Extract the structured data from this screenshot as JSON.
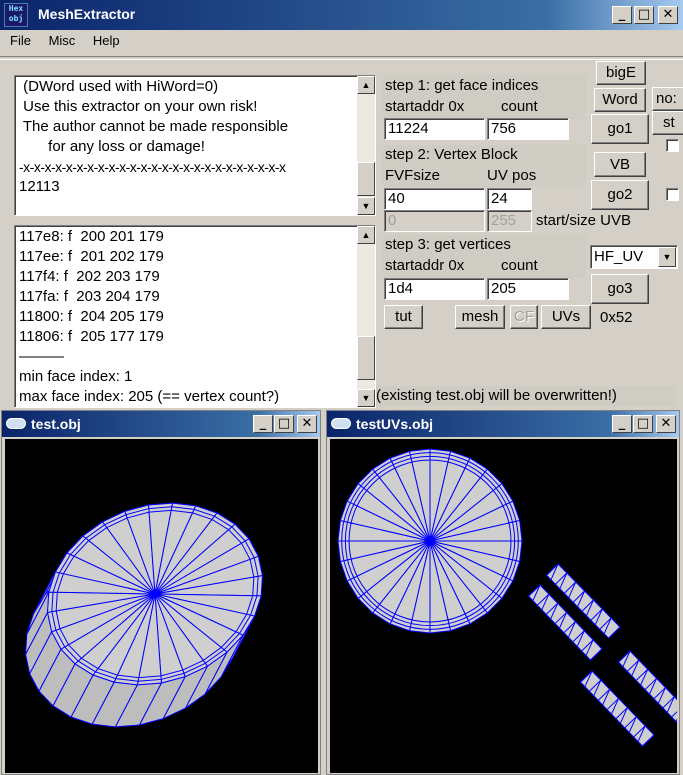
{
  "main_window": {
    "title": "MeshExtractor",
    "icon_text_top": "Hex",
    "icon_text_bottom": "obj",
    "minimize": "_",
    "maximize": "□",
    "close": "✕"
  },
  "menu": [
    "File",
    "Misc",
    "Help"
  ],
  "info_text": {
    "lines": [
      " (DWord used with HiWord=0)",
      "",
      " Use this extractor on your own risk!",
      " The author cannot be made responsible",
      "       for any loss or damage!",
      "-x-x-x-x-x-x-x-x-x-x-x-x-x-x-x-x-x-x-x-x-x-x-x-x-x",
      "12113"
    ]
  },
  "log_text": {
    "lines": [
      "117e8: f  200 201 179",
      "117ee: f  201 202 179",
      "117f4: f  202 203 179",
      "117fa: f  203 204 179",
      "11800: f  204 205 179",
      "11806: f  205 177 179",
      "———",
      "min face index: 1",
      "max face index: 205 (== vertex count?)"
    ]
  },
  "step1": {
    "title": "step 1: get face indices",
    "startaddr_label": "startaddr 0x",
    "count_label": "count",
    "startaddr_value": "11224",
    "count_value": "756",
    "go_label": "go1"
  },
  "step2": {
    "title": "step 2: Vertex Block",
    "fvfsize_label": "FVFsize",
    "uvpos_label": "UV pos",
    "fvfsize_value": "40",
    "uvpos_value": "24",
    "uvb_start_value": "0",
    "uvb_size_value": "255",
    "uvb_label": "start/size UVB",
    "go_label": "go2",
    "vb_label": "VB"
  },
  "step3": {
    "title": "step 3: get vertices",
    "startaddr_label": "startaddr 0x",
    "count_label": "count",
    "startaddr_value": "1d4",
    "count_value": "205",
    "go_label": "go3",
    "format_select": "HF_UV"
  },
  "buttons": {
    "bigE": "bigE",
    "word": "Word",
    "tut": "tut",
    "mesh": "mesh",
    "cf": "CF",
    "uvs": "UVs",
    "hex_value": "0x52",
    "clipped_1": "no:",
    "clipped_2": "st"
  },
  "status": "(existing test.obj will be overwritten!)",
  "window_test": {
    "title": "test.obj"
  },
  "window_uvs": {
    "title": "testUVs.obj"
  },
  "colors": {
    "mesh_fill": "#cfcfcf",
    "mesh_edge": "#0000ff",
    "viewport_bg": "#000000",
    "titlebar_start": "#0a246a",
    "titlebar_end": "#a6caf0"
  }
}
